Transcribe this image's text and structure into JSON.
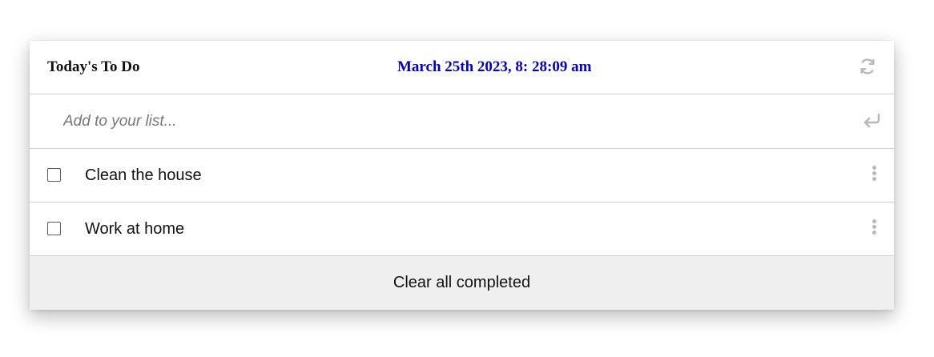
{
  "header": {
    "title": "Today's To Do",
    "datetime": "March 25th 2023, 8: 28:09 am",
    "datetime_color": "#0000cc",
    "refresh_icon": "refresh-icon"
  },
  "add": {
    "placeholder": "Add to your list...",
    "enter_icon": "enter-icon"
  },
  "items": [
    {
      "label": "Clean the house",
      "checked": false
    },
    {
      "label": "Work at home",
      "checked": false
    }
  ],
  "footer": {
    "clear_label": "Clear all completed"
  },
  "colors": {
    "divider": "#cfcfcf",
    "footer_bg": "#efefef",
    "icon_gray": "#b8b8b8"
  }
}
